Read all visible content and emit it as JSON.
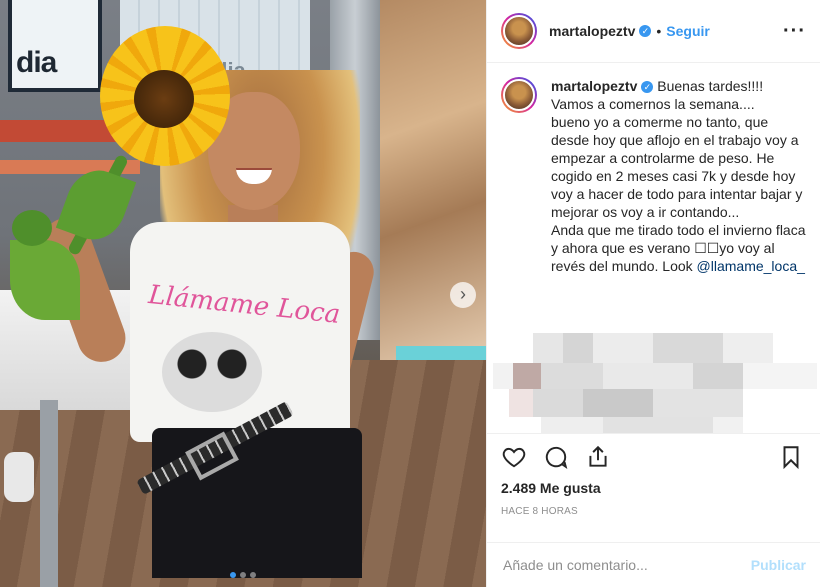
{
  "post": {
    "media": {
      "studio_sign_1": "dia",
      "studio_sign_2": "dia",
      "shirt_print": "Llámame Loca",
      "next_icon": "chevron-right-icon",
      "carousel_dots": 3,
      "carousel_active_index": 0
    },
    "header": {
      "username": "martalopeztv",
      "verified_icon": "verified-badge-icon",
      "separator": "•",
      "follow_label": "Seguir",
      "more_icon": "more-options-icon"
    },
    "caption": {
      "username": "martalopeztv",
      "body": "Buenas tardes!!!!\nVamos a comernos la semana....\nbueno yo a comerme no tanto, que desde hoy que aflojo en el trabajo voy a empezar a controlarme de peso. He cogido en 2 meses casi 7k y desde hoy voy a hacer de todo para intentar bajar y mejorar os voy a ir contando...\nAnda que me tirado todo el invierno flaca y ahora que es verano ☐☐yo voy al revés del mundo. Look ",
      "mention": "@llamame_loca_"
    },
    "actions": {
      "like_icon": "heart-icon",
      "comment_icon": "comment-icon",
      "share_icon": "share-icon",
      "save_icon": "bookmark-icon"
    },
    "likes_text": "2.489 Me gusta",
    "timestamp": "HACE 8 HORAS",
    "comment_box": {
      "placeholder": "Añade un comentario...",
      "publish_label": "Publicar"
    },
    "colors": {
      "accent": "#3897f0",
      "publish_disabled": "#b2dffc",
      "muted": "#8e8e8e",
      "text": "#262626"
    }
  }
}
